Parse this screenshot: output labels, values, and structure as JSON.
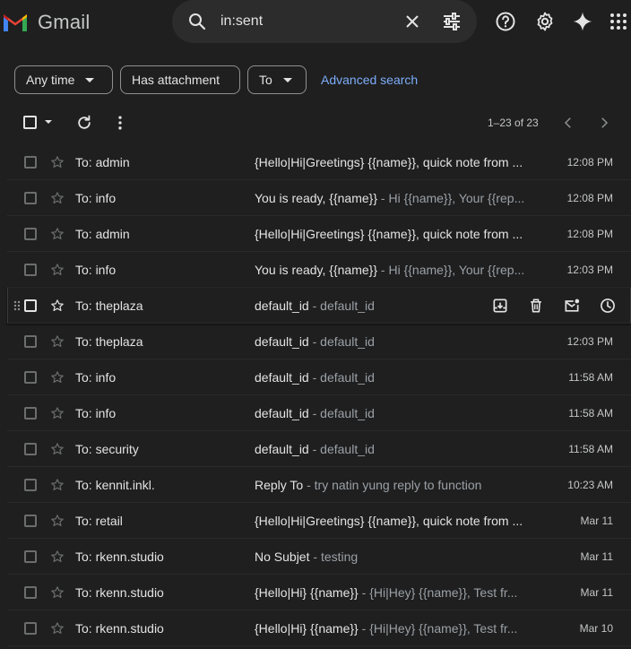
{
  "app": {
    "name": "Gmail"
  },
  "search": {
    "value": "in:sent"
  },
  "filters": {
    "any_time": "Any time",
    "has_attachment": "Has attachment",
    "to": "To",
    "advanced": "Advanced search"
  },
  "pagination": {
    "info": "1–23 of 23"
  },
  "emails": [
    {
      "to": "To: admin",
      "subject": "{Hello|Hi|Greetings} {{name}}, quick note from ...",
      "snippet": "",
      "time": "12:08 PM"
    },
    {
      "to": "To: info",
      "subject": "You is ready, {{name}}",
      "snippet": "Hi {{name}}, Your {{rep...",
      "time": "12:08 PM"
    },
    {
      "to": "To: admin",
      "subject": "{Hello|Hi|Greetings} {{name}}, quick note from ...",
      "snippet": "",
      "time": "12:08 PM"
    },
    {
      "to": "To: info",
      "subject": "You is ready, {{name}}",
      "snippet": "Hi {{name}}, Your {{rep...",
      "time": "12:03 PM"
    },
    {
      "to": "To: theplaza",
      "subject": "default_id",
      "snippet": "default_id",
      "time": ""
    },
    {
      "to": "To: theplaza",
      "subject": "default_id",
      "snippet": "default_id",
      "time": "12:03 PM"
    },
    {
      "to": "To: info",
      "subject": "default_id",
      "snippet": "default_id",
      "time": "11:58 AM"
    },
    {
      "to": "To: info",
      "subject": "default_id",
      "snippet": "default_id",
      "time": "11:58 AM"
    },
    {
      "to": "To: security",
      "subject": "default_id",
      "snippet": "default_id",
      "time": "11:58 AM"
    },
    {
      "to": "To: kennit.inkl.",
      "subject": "Reply To",
      "snippet": "try natin yung reply to function",
      "time": "10:23 AM"
    },
    {
      "to": "To: retail",
      "subject": "{Hello|Hi|Greetings} {{name}}, quick note from ...",
      "snippet": "",
      "time": "Mar 11"
    },
    {
      "to": "To: rkenn.studio",
      "subject": "No Subjet",
      "snippet": "testing",
      "time": "Mar 11"
    },
    {
      "to": "To: rkenn.studio",
      "subject": "{Hello|Hi} {{name}}",
      "snippet": "{Hi|Hey} {{name}}, Test fr...",
      "time": "Mar 11"
    },
    {
      "to": "To: rkenn.studio",
      "subject": "{Hello|Hi} {{name}}",
      "snippet": "{Hi|Hey} {{name}}, Test fr...",
      "time": "Mar 10"
    }
  ],
  "hover_row": 4,
  "colors": {
    "link": "#7cacf8",
    "background": "#1f1f1f",
    "search_bg": "#2c2c2c"
  }
}
